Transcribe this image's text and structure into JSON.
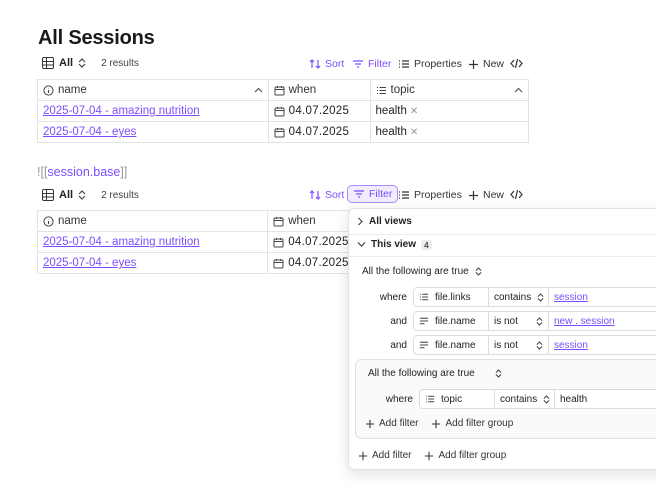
{
  "title": "All Sessions",
  "view1": {
    "view_name": "All",
    "result_count": "2 results",
    "toolbar": {
      "sort": "Sort",
      "filter": "Filter",
      "properties": "Properties",
      "new": "New"
    },
    "columns": {
      "name": "name",
      "when": "when",
      "topic": "topic"
    },
    "rows": [
      {
        "name": "2025-07-04 - amazing nutrition",
        "when": "04.07.2025",
        "topic": "health"
      },
      {
        "name": "2025-07-04 - eyes",
        "when": "04.07.2025",
        "topic": "health"
      }
    ]
  },
  "embed": {
    "open": "![[",
    "name": "session.base",
    "close": "]]"
  },
  "view2": {
    "view_name": "All",
    "result_count": "2 results",
    "toolbar": {
      "sort": "Sort",
      "filter": "Filter",
      "properties": "Properties",
      "new": "New"
    },
    "columns": {
      "name": "name",
      "when": "when"
    },
    "rows": [
      {
        "name": "2025-07-04 - amazing nutrition",
        "when": "04.07.2025"
      },
      {
        "name": "2025-07-04 - eyes",
        "when": "04.07.2025"
      }
    ]
  },
  "filter_popover": {
    "all_views": "All views",
    "this_view": "This view",
    "this_view_count": "4",
    "group_mode": "All the following are true",
    "conditions": [
      {
        "label": "where",
        "property": "file.links",
        "operator": "contains",
        "value": "session"
      },
      {
        "label": "and",
        "property": "file.name",
        "operator": "is not",
        "value": "new . session"
      },
      {
        "label": "and",
        "property": "file.name",
        "operator": "is not",
        "value": "session"
      }
    ],
    "subgroup": {
      "group_mode": "All the following are true",
      "condition": {
        "label": "where",
        "property": "topic",
        "operator": "contains",
        "value": "health"
      },
      "add_filter": "Add filter",
      "add_filter_group": "Add filter group"
    },
    "add_filter": "Add filter",
    "add_filter_group": "Add filter group"
  },
  "colors": {
    "accent": "#7c4dff",
    "border": "#e3e3e3"
  }
}
